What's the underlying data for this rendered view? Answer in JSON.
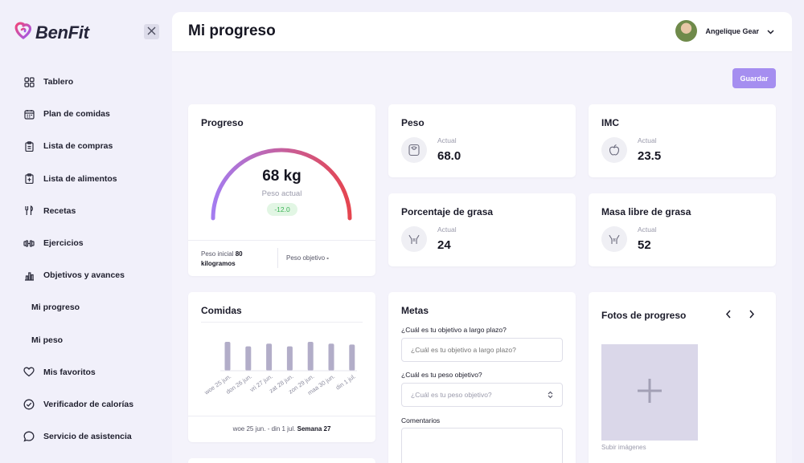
{
  "brand": {
    "name": "BenFit",
    "accent": "#e0457a"
  },
  "sidebar": {
    "items": [
      {
        "label": "Tablero",
        "icon": "grid-icon"
      },
      {
        "label": "Plan de comidas",
        "icon": "calendar-icon"
      },
      {
        "label": "Lista de compras",
        "icon": "clipboard-icon"
      },
      {
        "label": "Lista de alimentos",
        "icon": "clipboard-list-icon"
      },
      {
        "label": "Recetas",
        "icon": "utensils-icon"
      },
      {
        "label": "Ejercicios",
        "icon": "dumbbell-icon"
      },
      {
        "label": "Objetivos y avances",
        "icon": "bar-chart-icon"
      },
      {
        "label": "Mi progreso",
        "icon": ""
      },
      {
        "label": "Mi peso",
        "icon": ""
      },
      {
        "label": "Mis favoritos",
        "icon": "heart-icon"
      },
      {
        "label": "Verificador de calorías",
        "icon": "check-circle-icon"
      },
      {
        "label": "Servicio de asistencia",
        "icon": "chat-icon"
      }
    ]
  },
  "header": {
    "title": "Mi progreso",
    "user_name": "Angelique Gear"
  },
  "toolbar": {
    "save_label": "Guardar",
    "save_color": "#a58ef0"
  },
  "progress": {
    "title": "Progreso",
    "value": "68 kg",
    "sub": "Peso actual",
    "diff": "-12.0",
    "initial_label": "Peso inicial",
    "initial_value": "80 kilogramos",
    "target_label": "Peso objetivo",
    "target_value": "-"
  },
  "stats": {
    "peso": {
      "title": "Peso",
      "label": "Actual",
      "value": "68.0",
      "icon": "scale-icon"
    },
    "imc": {
      "title": "IMC",
      "label": "Actual",
      "value": "23.5",
      "icon": "apple-icon"
    },
    "grasa": {
      "title": "Porcentaje de grasa",
      "label": "Actual",
      "value": "24",
      "icon": "body-icon"
    },
    "masa": {
      "title": "Masa libre de grasa",
      "label": "Actual",
      "value": "52",
      "icon": "body-icon"
    }
  },
  "comidas": {
    "title": "Comidas",
    "footer_range": "woe 25 jun. - din 1 jul.",
    "footer_week": "Semana 27"
  },
  "chart_data": {
    "type": "bar",
    "categories": [
      "woe 25 jun.",
      "don 26 jun.",
      "vri 27 jun.",
      "zat 28 jun.",
      "zon 29 jun.",
      "maa 30 jun.",
      "din 1 jul."
    ],
    "values": [
      32,
      27,
      30,
      27,
      32,
      30,
      29
    ],
    "ylim": [
      0,
      40
    ],
    "bar_color": "#b2adc8",
    "grid": false
  },
  "metas": {
    "title": "Metas",
    "q1_label": "¿Cuál es tu objetivo a largo plazo?",
    "q1_placeholder": "¿Cuál es tu objetivo a largo plazo?",
    "q2_label": "¿Cuál es tu peso objetivo?",
    "q2_placeholder": "¿Cuál es tu peso objetivo?",
    "comments_label": "Comentarios"
  },
  "fotos": {
    "title": "Fotos de progreso",
    "upload_caption": "Subir imágenes"
  }
}
